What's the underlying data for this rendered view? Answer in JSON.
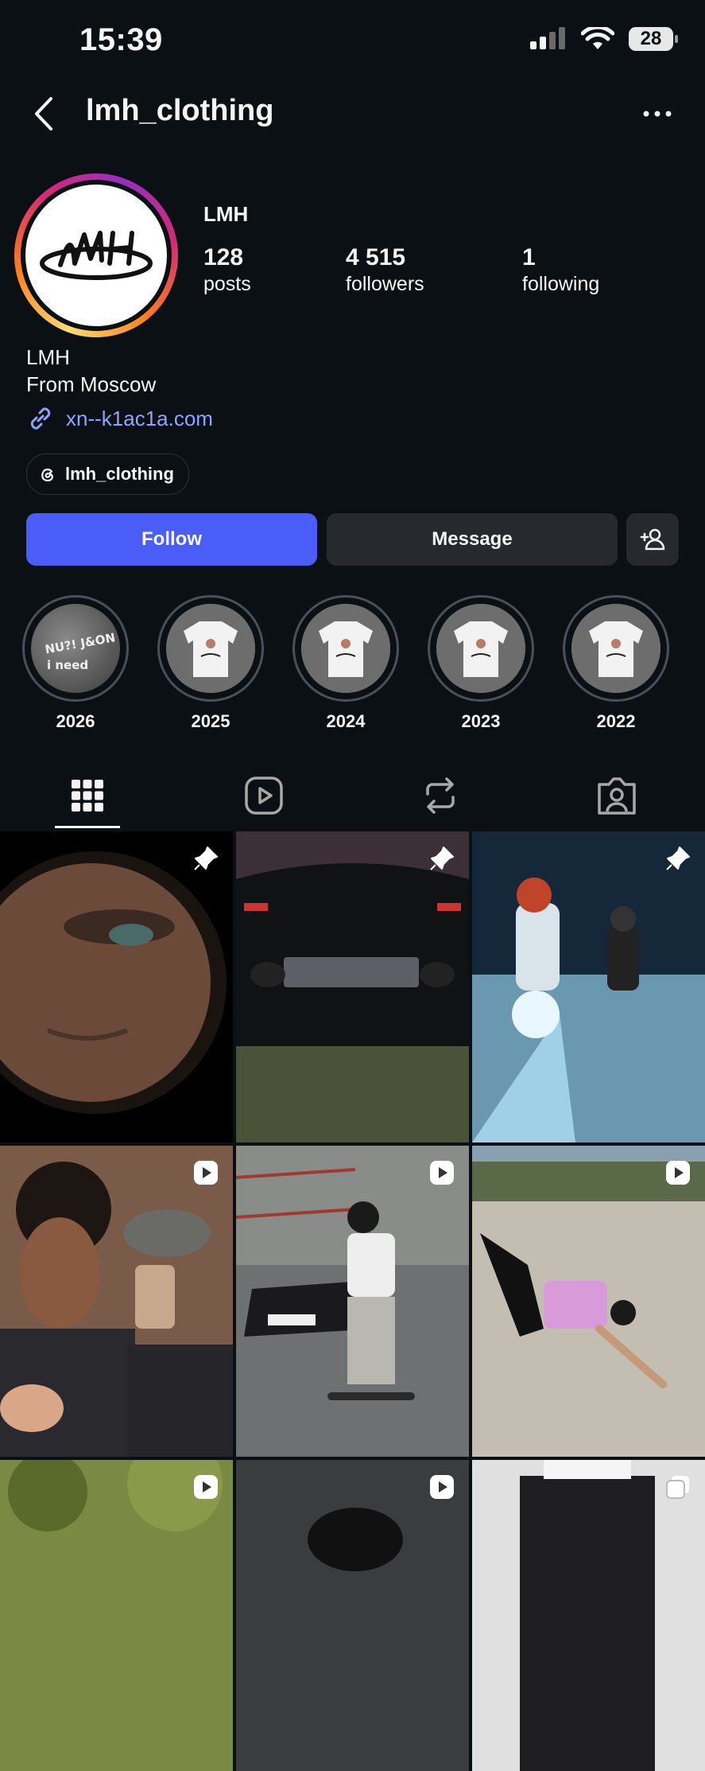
{
  "status_bar": {
    "time": "15:39",
    "battery": "28"
  },
  "header": {
    "username": "lmh_clothing"
  },
  "profile": {
    "display_name": "LMH",
    "stats": [
      {
        "value": "128",
        "label": "posts"
      },
      {
        "value": "4 515",
        "label": "followers"
      },
      {
        "value": "1",
        "label": "following"
      }
    ],
    "bio_name": "LMH",
    "bio_line": "From Moscow",
    "link": "xn--k1ac1a.com",
    "threads_handle": "lmh_clothing"
  },
  "actions": {
    "follow": "Follow",
    "message": "Message"
  },
  "highlights": [
    {
      "label": "2026"
    },
    {
      "label": "2025"
    },
    {
      "label": "2024"
    },
    {
      "label": "2023"
    },
    {
      "label": "2022"
    }
  ],
  "tabs": [
    "grid-icon",
    "reels-icon",
    "reposts-icon",
    "tagged-icon"
  ],
  "colors": {
    "accent": "#4a5df9",
    "background": "#0b1014",
    "link": "#8aa6ff"
  }
}
